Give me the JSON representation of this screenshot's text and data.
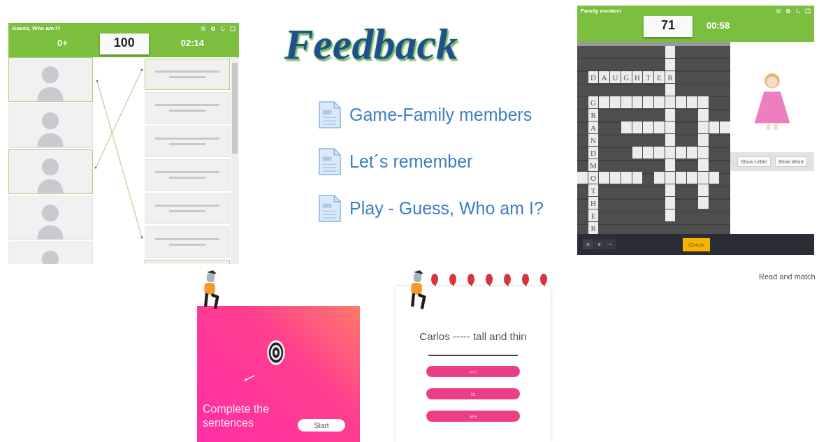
{
  "guess_game": {
    "title": "Guess, Who am I?",
    "left_stat": "0+",
    "score": "100",
    "timer": "02:14",
    "pictures": [
      {
        "selected": true
      },
      {
        "selected": false
      },
      {
        "selected": true
      },
      {
        "selected": false
      },
      {
        "selected": false
      }
    ],
    "cards": [
      {
        "selected": true
      },
      {
        "selected": false
      },
      {
        "selected": false
      },
      {
        "selected": false
      },
      {
        "selected": false
      },
      {
        "selected": false
      },
      {
        "selected": true
      }
    ]
  },
  "feedback": {
    "title": "Feedback",
    "links": [
      "Game-Family members",
      "Let´s remember",
      "Play - Guess, Who am I?"
    ]
  },
  "crossword": {
    "title": "Family member",
    "score": "71",
    "timer": "00:58",
    "across": [
      "D",
      "A",
      "U",
      "G",
      "H",
      "T",
      "E",
      "R"
    ],
    "down": [
      "G",
      "R",
      "A",
      "N",
      "D",
      "M",
      "O",
      "T",
      "H",
      "E",
      "R"
    ],
    "buttons": [
      "Show Letter",
      "Show Word"
    ],
    "check_button": "Check"
  },
  "caption": "Read and match",
  "intro_card": {
    "title": "Complete the sentences",
    "start_button": "Start"
  },
  "quiz": {
    "sentence": "Carlos ----- tall and thin",
    "options": [
      "am",
      "is",
      "are"
    ]
  }
}
